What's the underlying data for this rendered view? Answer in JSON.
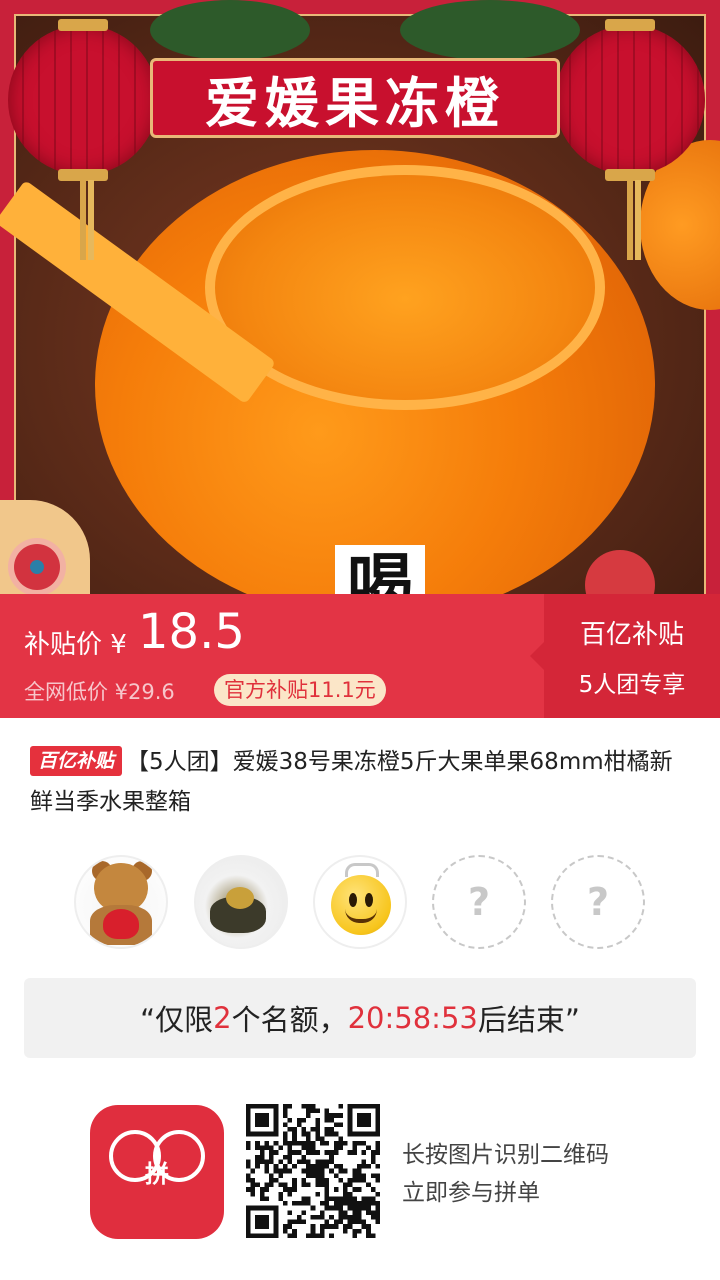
{
  "hero": {
    "title": "爱媛果冻橙",
    "big_char": "喝"
  },
  "price_bar": {
    "subsidy_label": "补贴价 ¥",
    "price": "18.5",
    "market_price": "全网低价 ¥29.6",
    "official_badge": "官方补贴11.1元",
    "right_title": "百亿补贴",
    "right_sub": "5人团专享",
    "colors": {
      "bar": "#e33445",
      "right": "#d42638",
      "badge_bg": "#fbe6c8"
    }
  },
  "product": {
    "tag": "百亿补贴",
    "title": "【5人团】爱媛38号果冻橙5斤大果单果68mm柑橘新鲜当季水果整箱"
  },
  "group": {
    "avatars": [
      {
        "type": "filled",
        "icon": "teddy-bear-avatar"
      },
      {
        "type": "filled",
        "icon": "photo-avatar"
      },
      {
        "type": "filled",
        "icon": "smiley-avatar"
      },
      {
        "type": "empty",
        "placeholder": "?"
      },
      {
        "type": "empty",
        "placeholder": "?"
      }
    ]
  },
  "countdown": {
    "open_quote": "“仅限",
    "slots": "2",
    "mid": "个名额，",
    "time": "20:58:53",
    "end": "后结束”"
  },
  "footer": {
    "logo_text": "拼",
    "qr_hint_line1": "长按图片识别二维码",
    "qr_hint_line2": "立即参与拼单"
  }
}
